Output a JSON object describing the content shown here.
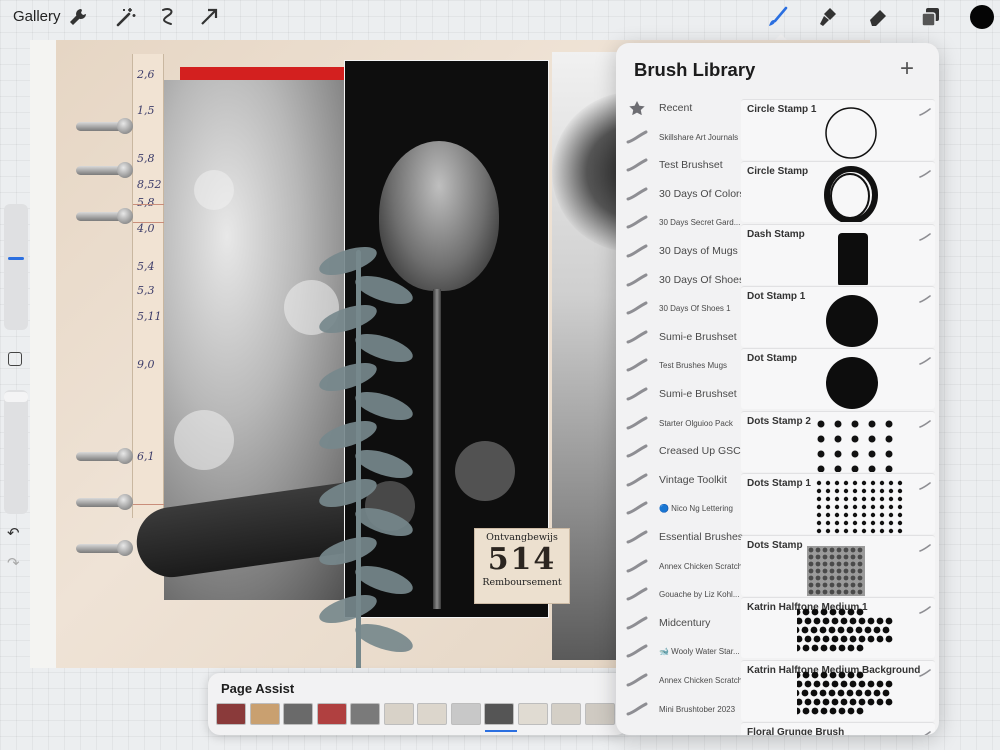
{
  "toolbar": {
    "gallery_label": "Gallery",
    "left_tools": [
      "wrench-icon",
      "magic-wand-icon",
      "selection-icon",
      "transform-icon"
    ],
    "right_tools": [
      "brush-icon",
      "smudge-icon",
      "eraser-icon",
      "layers-icon"
    ],
    "active_tool": "brush-icon",
    "current_color": "#050505",
    "accent_color": "#2b6fe0"
  },
  "sidebar": {
    "icons": [
      "brush-size-slider",
      "modify-button",
      "opacity-slider",
      "undo-icon",
      "redo-icon"
    ],
    "undo_glyph": "↶",
    "redo_glyph": "↷"
  },
  "canvas": {
    "ledger_numbers": [
      "2,6",
      "1,5",
      "5,8",
      "8,52",
      "5,8",
      "4,0",
      "5,4",
      "5,3",
      "5,11",
      "9,0",
      "6,1"
    ],
    "ticket": {
      "top": "Ontvangbewijs",
      "number": "514",
      "bottom": "Remboursement"
    }
  },
  "page_assist": {
    "title": "Page Assist",
    "thumbnail_count": 12,
    "active_index": 8
  },
  "brush_library": {
    "title": "Brush Library",
    "add_label": "+",
    "sets": [
      {
        "label": "Recent",
        "icon": "star-icon",
        "size": "normal"
      },
      {
        "label": "Skillshare Art Journals",
        "icon": "brush-set-icon",
        "size": "small"
      },
      {
        "label": "Test Brushset",
        "icon": "brush-set-icon",
        "size": "normal"
      },
      {
        "label": "30 Days Of Colors",
        "icon": "brush-set-icon",
        "size": "normal"
      },
      {
        "label": "30 Days Secret Gard...",
        "icon": "brush-set-icon",
        "size": "small"
      },
      {
        "label": "30 Days of Mugs",
        "icon": "brush-set-icon",
        "size": "normal"
      },
      {
        "label": "30 Days Of Shoes",
        "icon": "brush-set-icon",
        "size": "normal"
      },
      {
        "label": "30 Days Of Shoes 1",
        "icon": "brush-set-icon",
        "size": "small"
      },
      {
        "label": "Sumi-e Brushset",
        "icon": "brush-set-icon",
        "size": "normal"
      },
      {
        "label": "Test Brushes Mugs",
        "icon": "brush-set-icon",
        "size": "small"
      },
      {
        "label": "Sumi-e Brushset",
        "icon": "brush-set-icon",
        "size": "normal"
      },
      {
        "label": "Starter Olguioo Pack",
        "icon": "brush-set-icon",
        "size": "small"
      },
      {
        "label": "Creased Up GSC",
        "icon": "brush-set-icon",
        "size": "normal"
      },
      {
        "label": "Vintage Toolkit",
        "icon": "brush-set-icon",
        "size": "normal"
      },
      {
        "label": "🔵 Nico Ng Lettering",
        "icon": "brush-set-icon",
        "size": "small"
      },
      {
        "label": "Essential Brushes",
        "icon": "brush-set-icon",
        "size": "normal"
      },
      {
        "label": "Annex Chicken Scratch",
        "icon": "brush-set-icon",
        "size": "small"
      },
      {
        "label": "Gouache by Liz Kohl...",
        "icon": "brush-set-icon",
        "size": "small"
      },
      {
        "label": "Midcentury",
        "icon": "brush-set-icon",
        "size": "normal"
      },
      {
        "label": "🐋 Wooly Water Star...",
        "icon": "brush-set-icon",
        "size": "small"
      },
      {
        "label": "Annex Chicken Scratch",
        "icon": "brush-set-icon",
        "size": "small"
      },
      {
        "label": "Mini Brushtober 2023",
        "icon": "brush-set-icon",
        "size": "small"
      }
    ],
    "brushes": [
      {
        "label": "Circle Stamp  1",
        "stroke": "thin-circle"
      },
      {
        "label": "Circle Stamp",
        "stroke": "rough-circle"
      },
      {
        "label": "Dash Stamp",
        "stroke": "dash"
      },
      {
        "label": "Dot Stamp  1",
        "stroke": "dot"
      },
      {
        "label": "Dot Stamp",
        "stroke": "dot"
      },
      {
        "label": "Dots Stamp  2",
        "stroke": "dot-grid"
      },
      {
        "label": "Dots Stamp  1",
        "stroke": "dense-dot-grid"
      },
      {
        "label": "Dots Stamp",
        "stroke": "halftone-square"
      },
      {
        "label": "Katrin Halftone Medium 1",
        "stroke": "halftone-ellipse"
      },
      {
        "label": "Katrin Halftone Medium Background",
        "stroke": "halftone-ellipse"
      },
      {
        "label": "Floral Grunge Brush",
        "stroke": "grunge"
      }
    ]
  }
}
